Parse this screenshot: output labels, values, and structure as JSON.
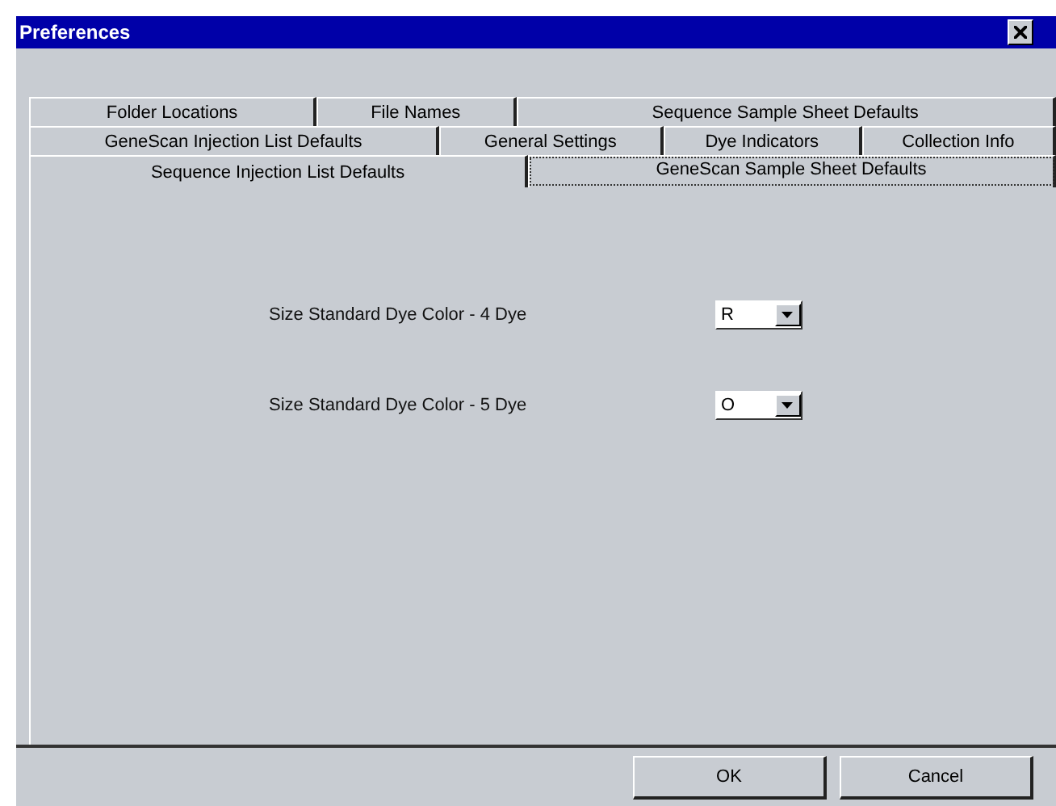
{
  "window": {
    "title": "Preferences"
  },
  "tab_rows": [
    [
      {
        "label": "Folder Locations",
        "selected": false
      },
      {
        "label": "File Names",
        "selected": false
      },
      {
        "label": "Sequence Sample Sheet Defaults",
        "selected": false
      }
    ],
    [
      {
        "label": "GeneScan Injection List Defaults",
        "selected": false
      },
      {
        "label": "General Settings",
        "selected": false
      },
      {
        "label": "Dye Indicators",
        "selected": false
      },
      {
        "label": "Collection Info",
        "selected": false
      }
    ],
    [
      {
        "label": "Sequence Injection List Defaults",
        "selected": false
      },
      {
        "label": "GeneScan Sample Sheet Defaults",
        "selected": true
      }
    ]
  ],
  "settings": [
    {
      "label": "Size Standard Dye Color - 4 Dye",
      "value": "R"
    },
    {
      "label": "Size Standard Dye Color - 5 Dye",
      "value": "O"
    }
  ],
  "buttons": [
    "OK",
    "Cancel"
  ]
}
